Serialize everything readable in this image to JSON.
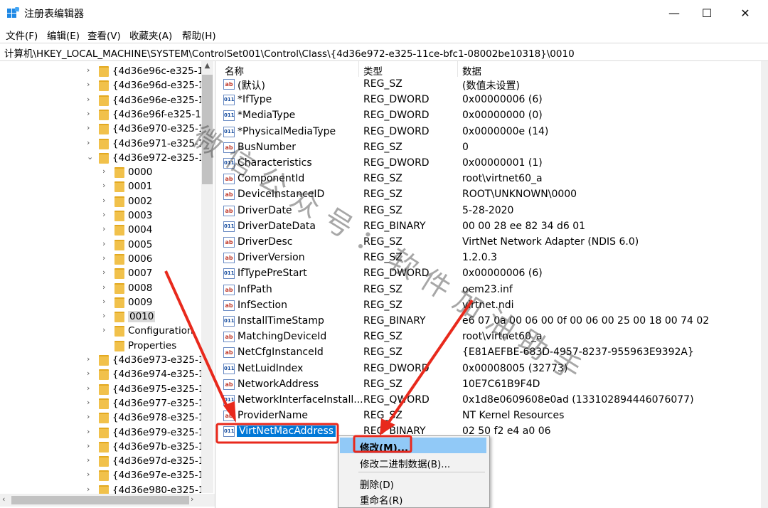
{
  "window": {
    "title": "注册表编辑器",
    "minimize_glyph": "—",
    "maximize_glyph": "☐",
    "close_glyph": "✕",
    "icon": "registry-editor-icon"
  },
  "menu": [
    "文件(F)",
    "编辑(E)",
    "查看(V)",
    "收藏夹(A)",
    "帮助(H)"
  ],
  "address": "计算机\\HKEY_LOCAL_MACHINE\\SYSTEM\\ControlSet001\\Control\\Class\\{4d36e972-e325-11ce-bfc1-08002be10318}\\0010",
  "tree": {
    "items": [
      {
        "label": "{4d36e96c-e325-1",
        "chevron": "›",
        "selected": false
      },
      {
        "label": "{4d36e96d-e325-1",
        "chevron": "›",
        "selected": false
      },
      {
        "label": "{4d36e96e-e325-1",
        "chevron": "›",
        "selected": false
      },
      {
        "label": "{4d36e96f-e325-1",
        "chevron": "›",
        "selected": false
      },
      {
        "label": "{4d36e970-e325-1",
        "chevron": "›",
        "selected": false
      },
      {
        "label": "{4d36e971-e325-1",
        "chevron": "›",
        "selected": false
      },
      {
        "label": "{4d36e972-e325-1",
        "chevron": "⌄",
        "selected": false
      },
      {
        "label": "0000",
        "chevron": "›",
        "selected": false
      },
      {
        "label": "0001",
        "chevron": "›",
        "selected": false
      },
      {
        "label": "0002",
        "chevron": "›",
        "selected": false
      },
      {
        "label": "0003",
        "chevron": "›",
        "selected": false
      },
      {
        "label": "0004",
        "chevron": "›",
        "selected": false
      },
      {
        "label": "0005",
        "chevron": "›",
        "selected": false
      },
      {
        "label": "0006",
        "chevron": "›",
        "selected": false
      },
      {
        "label": "0007",
        "chevron": "›",
        "selected": false
      },
      {
        "label": "0008",
        "chevron": "›",
        "selected": false
      },
      {
        "label": "0009",
        "chevron": "›",
        "selected": false
      },
      {
        "label": "0010",
        "chevron": "›",
        "selected": true
      },
      {
        "label": "Configuration",
        "chevron": "›",
        "selected": false
      },
      {
        "label": "Properties",
        "chevron": "",
        "selected": false
      },
      {
        "label": "{4d36e973-e325-1",
        "chevron": "›",
        "selected": false
      },
      {
        "label": "{4d36e974-e325-1",
        "chevron": "›",
        "selected": false
      },
      {
        "label": "{4d36e975-e325-1",
        "chevron": "›",
        "selected": false
      },
      {
        "label": "{4d36e977-e325-1",
        "chevron": "›",
        "selected": false
      },
      {
        "label": "{4d36e978-e325-1",
        "chevron": "›",
        "selected": false
      },
      {
        "label": "{4d36e979-e325-1",
        "chevron": "›",
        "selected": false
      },
      {
        "label": "{4d36e97b-e325-1",
        "chevron": "›",
        "selected": false
      },
      {
        "label": "{4d36e97d-e325-1",
        "chevron": "›",
        "selected": false
      },
      {
        "label": "{4d36e97e-e325-1",
        "chevron": "›",
        "selected": false
      },
      {
        "label": "{4d36e980-e325-1",
        "chevron": "›",
        "selected": false
      }
    ]
  },
  "list": {
    "headers": {
      "name": "名称",
      "type": "类型",
      "data": "数据"
    },
    "rows": [
      {
        "name": "(默认)",
        "type": "REG_SZ",
        "data": "(数值未设置)",
        "icon": "string-value-icon"
      },
      {
        "name": "*IfType",
        "type": "REG_DWORD",
        "data": "0x00000006 (6)",
        "icon": "binary-value-icon"
      },
      {
        "name": "*MediaType",
        "type": "REG_DWORD",
        "data": "0x00000000 (0)",
        "icon": "binary-value-icon"
      },
      {
        "name": "*PhysicalMediaType",
        "type": "REG_DWORD",
        "data": "0x0000000e (14)",
        "icon": "binary-value-icon"
      },
      {
        "name": "BusNumber",
        "type": "REG_SZ",
        "data": "0",
        "icon": "string-value-icon"
      },
      {
        "name": "Characteristics",
        "type": "REG_DWORD",
        "data": "0x00000001 (1)",
        "icon": "binary-value-icon"
      },
      {
        "name": "ComponentId",
        "type": "REG_SZ",
        "data": "root\\virtnet60_a",
        "icon": "string-value-icon"
      },
      {
        "name": "DeviceInstanceID",
        "type": "REG_SZ",
        "data": "ROOT\\UNKNOWN\\0000",
        "icon": "string-value-icon"
      },
      {
        "name": "DriverDate",
        "type": "REG_SZ",
        "data": "5-28-2020",
        "icon": "string-value-icon"
      },
      {
        "name": "DriverDateData",
        "type": "REG_BINARY",
        "data": "00 00 28 ee 82 34 d6 01",
        "icon": "binary-value-icon"
      },
      {
        "name": "DriverDesc",
        "type": "REG_SZ",
        "data": "VirtNet Network Adapter (NDIS 6.0)",
        "icon": "string-value-icon"
      },
      {
        "name": "DriverVersion",
        "type": "REG_SZ",
        "data": "1.2.0.3",
        "icon": "string-value-icon"
      },
      {
        "name": "IfTypePreStart",
        "type": "REG_DWORD",
        "data": "0x00000006 (6)",
        "icon": "binary-value-icon"
      },
      {
        "name": "InfPath",
        "type": "REG_SZ",
        "data": "oem23.inf",
        "icon": "string-value-icon"
      },
      {
        "name": "InfSection",
        "type": "REG_SZ",
        "data": "virtnet.ndi",
        "icon": "string-value-icon"
      },
      {
        "name": "InstallTimeStamp",
        "type": "REG_BINARY",
        "data": "e6 07 0a 00 06 00 0f 00 06 00 25 00 18 00 74 02",
        "icon": "binary-value-icon"
      },
      {
        "name": "MatchingDeviceId",
        "type": "REG_SZ",
        "data": "root\\virtnet60_a",
        "icon": "string-value-icon"
      },
      {
        "name": "NetCfgInstanceId",
        "type": "REG_SZ",
        "data": "{E81AEFBE-683D-4957-8237-955963E9392A}",
        "icon": "string-value-icon"
      },
      {
        "name": "NetLuidIndex",
        "type": "REG_DWORD",
        "data": "0x00008005 (32773)",
        "icon": "binary-value-icon"
      },
      {
        "name": "NetworkAddress",
        "type": "REG_SZ",
        "data": "10E7C61B9F4D",
        "icon": "string-value-icon"
      },
      {
        "name": "NetworkInterfaceInstall...",
        "type": "REG_QWORD",
        "data": "0x1d8e0609608e0ad (133102894446076077)",
        "icon": "binary-value-icon"
      },
      {
        "name": "ProviderName",
        "type": "REG_SZ",
        "data": "NT Kernel Resources",
        "icon": "string-value-icon"
      },
      {
        "name": "VirtNetMacAddress",
        "type": "REG_BINARY",
        "data": "02 50 f2 e4 a0 06",
        "icon": "binary-value-icon",
        "selected": true
      }
    ]
  },
  "context_menu": {
    "items": [
      "修改(M)...",
      "修改二进制数据(B)...",
      "删除(D)",
      "重命名(R)"
    ]
  },
  "watermark": "微信公众号：软件加油助手",
  "colors": {
    "selection": "#0078d7",
    "annotation": "#e8291c",
    "menu_highlight": "#91c9f7",
    "folder": "#f1c14b"
  }
}
